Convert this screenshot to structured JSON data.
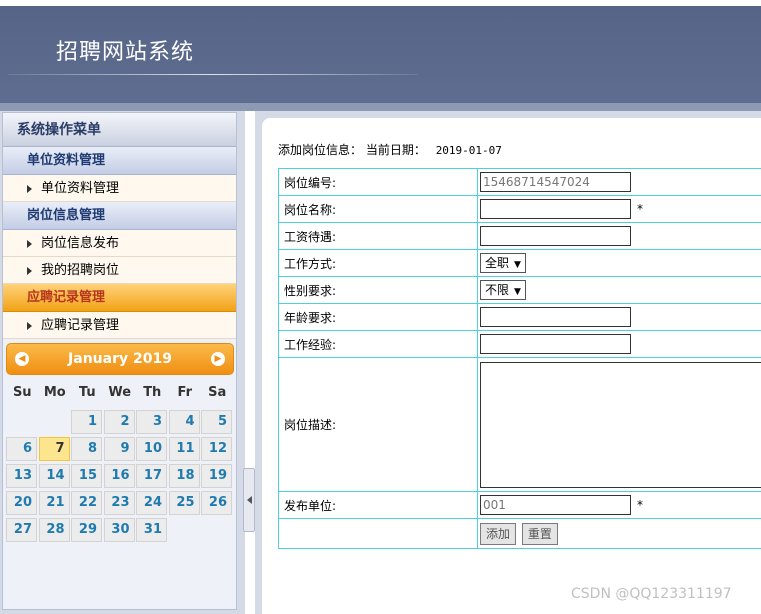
{
  "header": {
    "title": "招聘网站系统"
  },
  "menu": {
    "title": "系统操作菜单",
    "groups": [
      {
        "label": "单位资料管理",
        "items": [
          {
            "label": "单位资料管理"
          }
        ]
      },
      {
        "label": "岗位信息管理",
        "items": [
          {
            "label": "岗位信息发布"
          },
          {
            "label": "我的招聘岗位"
          }
        ]
      },
      {
        "label": "应聘记录管理",
        "items": [
          {
            "label": "应聘记录管理"
          }
        ]
      }
    ]
  },
  "calendar": {
    "month_label": "January 2019",
    "weekdays": [
      "Su",
      "Mo",
      "Tu",
      "We",
      "Th",
      "Fr",
      "Sa"
    ],
    "days": [
      "",
      "",
      "1",
      "2",
      "3",
      "4",
      "5",
      "6",
      "7",
      "8",
      "9",
      "10",
      "11",
      "12",
      "13",
      "14",
      "15",
      "16",
      "17",
      "18",
      "19",
      "20",
      "21",
      "22",
      "23",
      "24",
      "25",
      "26",
      "27",
      "28",
      "29",
      "30",
      "31",
      "",
      ""
    ],
    "today": "7"
  },
  "form": {
    "heading": "添加岗位信息：",
    "date_label": "当前日期：",
    "date_value": "2019-01-07",
    "fields": {
      "job_id": {
        "label": "岗位编号:",
        "value": "15468714547024"
      },
      "job_name": {
        "label": "岗位名称:",
        "value": "",
        "required": "*"
      },
      "salary": {
        "label": "工资待遇:",
        "value": ""
      },
      "work_mode": {
        "label": "工作方式:",
        "selected": "全职"
      },
      "gender": {
        "label": "性别要求:",
        "selected": "不限"
      },
      "age": {
        "label": "年龄要求:",
        "value": ""
      },
      "experience": {
        "label": "工作经验:",
        "value": ""
      },
      "description": {
        "label": "岗位描述:",
        "value": ""
      },
      "publisher": {
        "label": "发布单位:",
        "value": "001",
        "required": "*"
      }
    },
    "buttons": {
      "submit": "添加",
      "reset": "重置"
    }
  },
  "watermark": "CSDN @QQ123311197"
}
